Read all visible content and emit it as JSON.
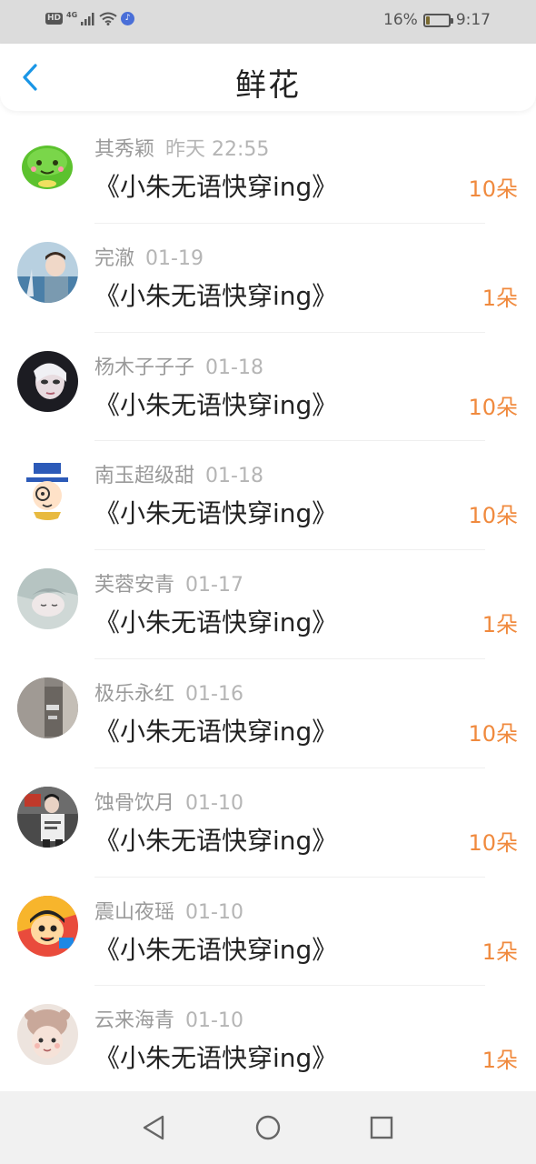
{
  "status": {
    "battery_percent": "16%",
    "battery_level": 0.16,
    "time": "9:17",
    "network_badge": "HD",
    "network_type": "4G",
    "icons": [
      "signal-icon",
      "wifi-icon",
      "music-icon",
      "battery-icon"
    ]
  },
  "header": {
    "title": "鲜花",
    "back_icon": "chevron-left-icon",
    "accent_color": "#1a96e6"
  },
  "colors": {
    "count": "#f08a3e",
    "name": "#9a9a9a",
    "date": "#b5b5b5"
  },
  "items": [
    {
      "name": "其秀颖",
      "date": "昨天 22:55",
      "book": "《小朱无语快穿ing》",
      "count": "10朵",
      "avatar": "green-monster-avatar"
    },
    {
      "name": "完澈",
      "date": "01-19",
      "book": "《小朱无语快穿ing》",
      "count": "1朵",
      "avatar": "boy-seaside-avatar"
    },
    {
      "name": "杨木子子子",
      "date": "01-18",
      "book": "《小朱无语快穿ing》",
      "count": "10朵",
      "avatar": "dark-portrait-avatar"
    },
    {
      "name": "南玉超级甜",
      "date": "01-18",
      "book": "《小朱无语快穿ing》",
      "count": "10朵",
      "avatar": "cartoon-hat-avatar"
    },
    {
      "name": "芙蓉安青",
      "date": "01-17",
      "book": "《小朱无语快穿ing》",
      "count": "1朵",
      "avatar": "anime-sleeping-avatar"
    },
    {
      "name": "极乐永红",
      "date": "01-16",
      "book": "《小朱无语快穿ing》",
      "count": "10朵",
      "avatar": "gray-photo-avatar"
    },
    {
      "name": "蚀骨饮月",
      "date": "01-10",
      "book": "《小朱无语快穿ing》",
      "count": "10朵",
      "avatar": "street-photo-avatar"
    },
    {
      "name": "震山夜瑶",
      "date": "01-10",
      "book": "《小朱无语快穿ing》",
      "count": "1朵",
      "avatar": "orange-cartoon-avatar"
    },
    {
      "name": "云来海青",
      "date": "01-10",
      "book": "《小朱无语快穿ing》",
      "count": "1朵",
      "avatar": "child-hat-avatar"
    }
  ],
  "navbar": {
    "icons": [
      "back-triangle-icon",
      "home-circle-icon",
      "recent-square-icon"
    ]
  }
}
